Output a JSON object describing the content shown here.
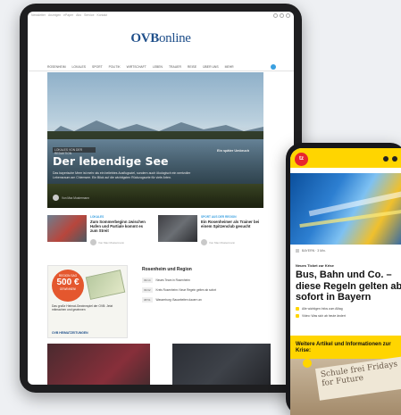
{
  "tablet": {
    "toplinks": [
      "Newsletter",
      "Anzeigen",
      "ePaper",
      "Abo",
      "Service",
      "Kontakt"
    ],
    "logo_main": "OVB",
    "logo_sub": "online",
    "nav": [
      "ROSENHEIM",
      "LOKALES",
      "SPORT",
      "POLITIK",
      "WIRTSCHAFT",
      "LEBEN",
      "TRAUER",
      "REISE",
      "ÜBER UNS",
      "MEHR"
    ],
    "hero": {
      "kicker": "LOKALES VON DER REDAKTION",
      "title": "Der lebendige See",
      "teaser": "Das bayerische Meer ist mehr als ein beliebtes Ausflugsziel, sondern auch ökologisch ein wertvoller Lebensraum am Chiemsee. Ein Blick auf die wichtigsten Rückzugsorte für viele Arten.",
      "author": "Von Max Mustermann",
      "side": "Ein später Umbruch"
    },
    "cards": [
      {
        "kicker": "LOKALES",
        "title": "Zum Sommerbeginn zwischen Hafen und Partiale kommt es zum Streit",
        "author": "Von Max Mustermann"
      },
      {
        "kicker": "SPORT AUS DER REGION",
        "title": "Ein Rosenheimer als Trainer bei einem Spitzenclub gesucht",
        "author": "Von Max Mustermann"
      }
    ],
    "ad": {
      "badge_top": "REGION SAG",
      "badge_amount": "500 €",
      "badge_bottom": "GEWINNEN!",
      "copy": "Das große Heimat-Gewinnspiel der OVB: Jetzt mitmachen und gewinnen",
      "brand": "OVB HEIMATZEITUNGEN"
    },
    "region": {
      "heading": "Rosenheim und Region",
      "rows": [
        {
          "time": "09:14",
          "text": "Neues Team in Rosenheim"
        },
        {
          "time": "09:02",
          "text": "Kreis Rosenheim: Neue Regeln gelten ab sofort"
        },
        {
          "time": "08:51",
          "text": "Wasserburg: Bauarbeiten dauern an"
        }
      ]
    }
  },
  "phone": {
    "logo": "tz",
    "meta": "BAYERN · 3 Min.",
    "kicker": "Neues Ticket zur Krise",
    "title": "Bus, Bahn und Co. – diese Regeln gelten ab sofort in Bayern",
    "bullets": [
      "Alle wichtigen Infos zum Alltag",
      "Video: Was sich ab heute ändert"
    ],
    "more_heading": "Weitere Artikel und Informationen zur Krise:",
    "sign_text": "Schule frei Fridays for Future"
  }
}
